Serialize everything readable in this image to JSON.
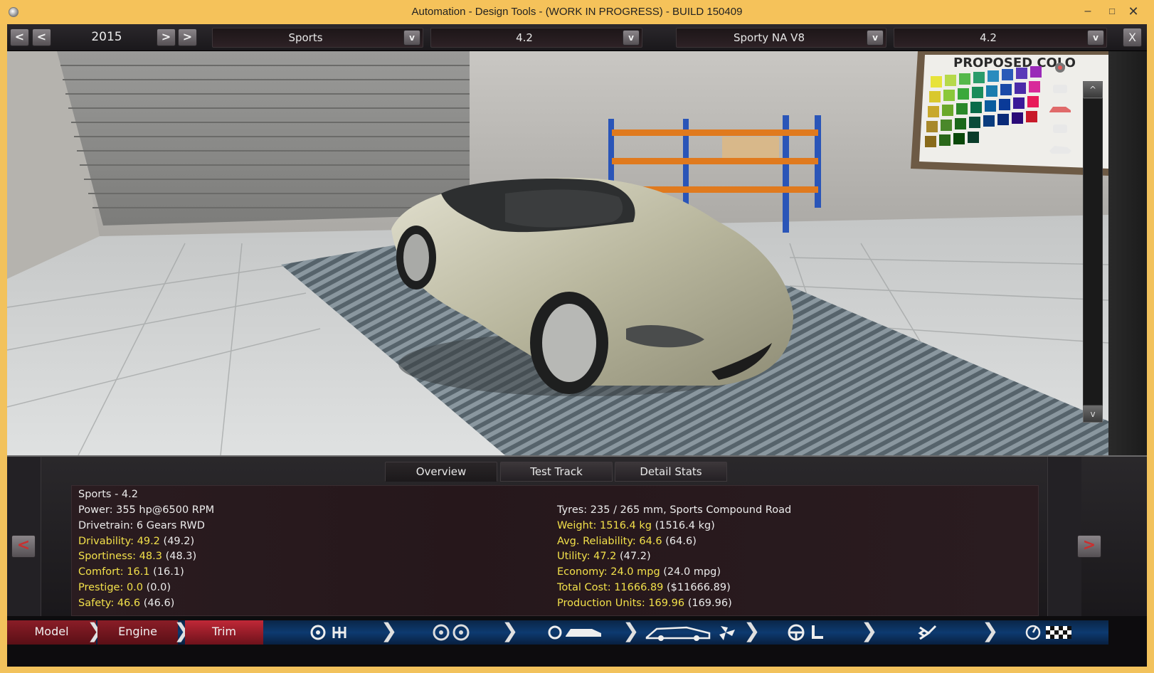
{
  "window": {
    "title": "Automation - Design Tools - (WORK IN PROGRESS) - BUILD 150409",
    "minimize": "–",
    "maximize": "□",
    "close": "✕"
  },
  "topbar": {
    "year_prev_fast": "<",
    "year_prev": "<",
    "year": "2015",
    "year_next": ">",
    "year_next_fast": ">",
    "model": "Sports",
    "model_trim": "4.2",
    "engine": "Sporty NA V8",
    "engine_variant": "4.2",
    "dropdown_glyph": "v",
    "close": "X"
  },
  "viewport": {
    "poster_text": "PROPOSED COLO",
    "scroll_up": "^",
    "scroll_down": "v"
  },
  "tabs": [
    {
      "label": "Overview",
      "active": true
    },
    {
      "label": "Test Track",
      "active": false
    },
    {
      "label": "Detail Stats",
      "active": false
    }
  ],
  "stats": {
    "header": "Sports - 4.2",
    "left": [
      {
        "label": "Power: ",
        "value": "355 hp@6500 RPM",
        "extra": "",
        "color": "white"
      },
      {
        "label": "Drivetrain: ",
        "value": "6 Gears RWD",
        "extra": "",
        "color": "white"
      },
      {
        "label": "Drivability: ",
        "value": "49.2",
        "extra": "(49.2)",
        "color": "yellow"
      },
      {
        "label": "Sportiness: ",
        "value": "48.3",
        "extra": "(48.3)",
        "color": "yellow"
      },
      {
        "label": "Comfort: ",
        "value": "16.1",
        "extra": "(16.1)",
        "color": "yellow"
      },
      {
        "label": "Prestige: ",
        "value": "0.0",
        "extra": "(0.0)",
        "color": "yellow"
      },
      {
        "label": "Safety: ",
        "value": "46.6",
        "extra": "(46.6)",
        "color": "yellow"
      }
    ],
    "right": [
      {
        "label": "Tyres: ",
        "value": "235 / 265 mm, Sports Compound Road",
        "extra": "",
        "color": "white"
      },
      {
        "label": "Weight: ",
        "value": "1516.4 kg",
        "extra": "(1516.4 kg)",
        "color": "yellow"
      },
      {
        "label": "Avg. Reliability: ",
        "value": "64.6",
        "extra": "(64.6)",
        "color": "yellow"
      },
      {
        "label": "Utility: ",
        "value": "47.2",
        "extra": "(47.2)",
        "color": "yellow"
      },
      {
        "label": "Economy: ",
        "value": "24.0 mpg",
        "extra": "(24.0 mpg)",
        "color": "yellow"
      },
      {
        "label": "Total Cost: ",
        "value": "11666.89",
        "extra": "($11666.89)",
        "color": "yellow"
      },
      {
        "label": "Production Units: ",
        "value": "169.96",
        "extra": "(169.96)",
        "color": "yellow"
      }
    ],
    "prev": "<",
    "next": ">"
  },
  "bottom_nav": {
    "model": "Model",
    "engine": "Engine",
    "trim": "Trim",
    "chevron": "❯"
  },
  "colors": {
    "accent_yellow": "#f2e04a",
    "nav_red": "#c02837",
    "nav_blue": "#0d3a70",
    "window_frame": "#f5c25a"
  }
}
